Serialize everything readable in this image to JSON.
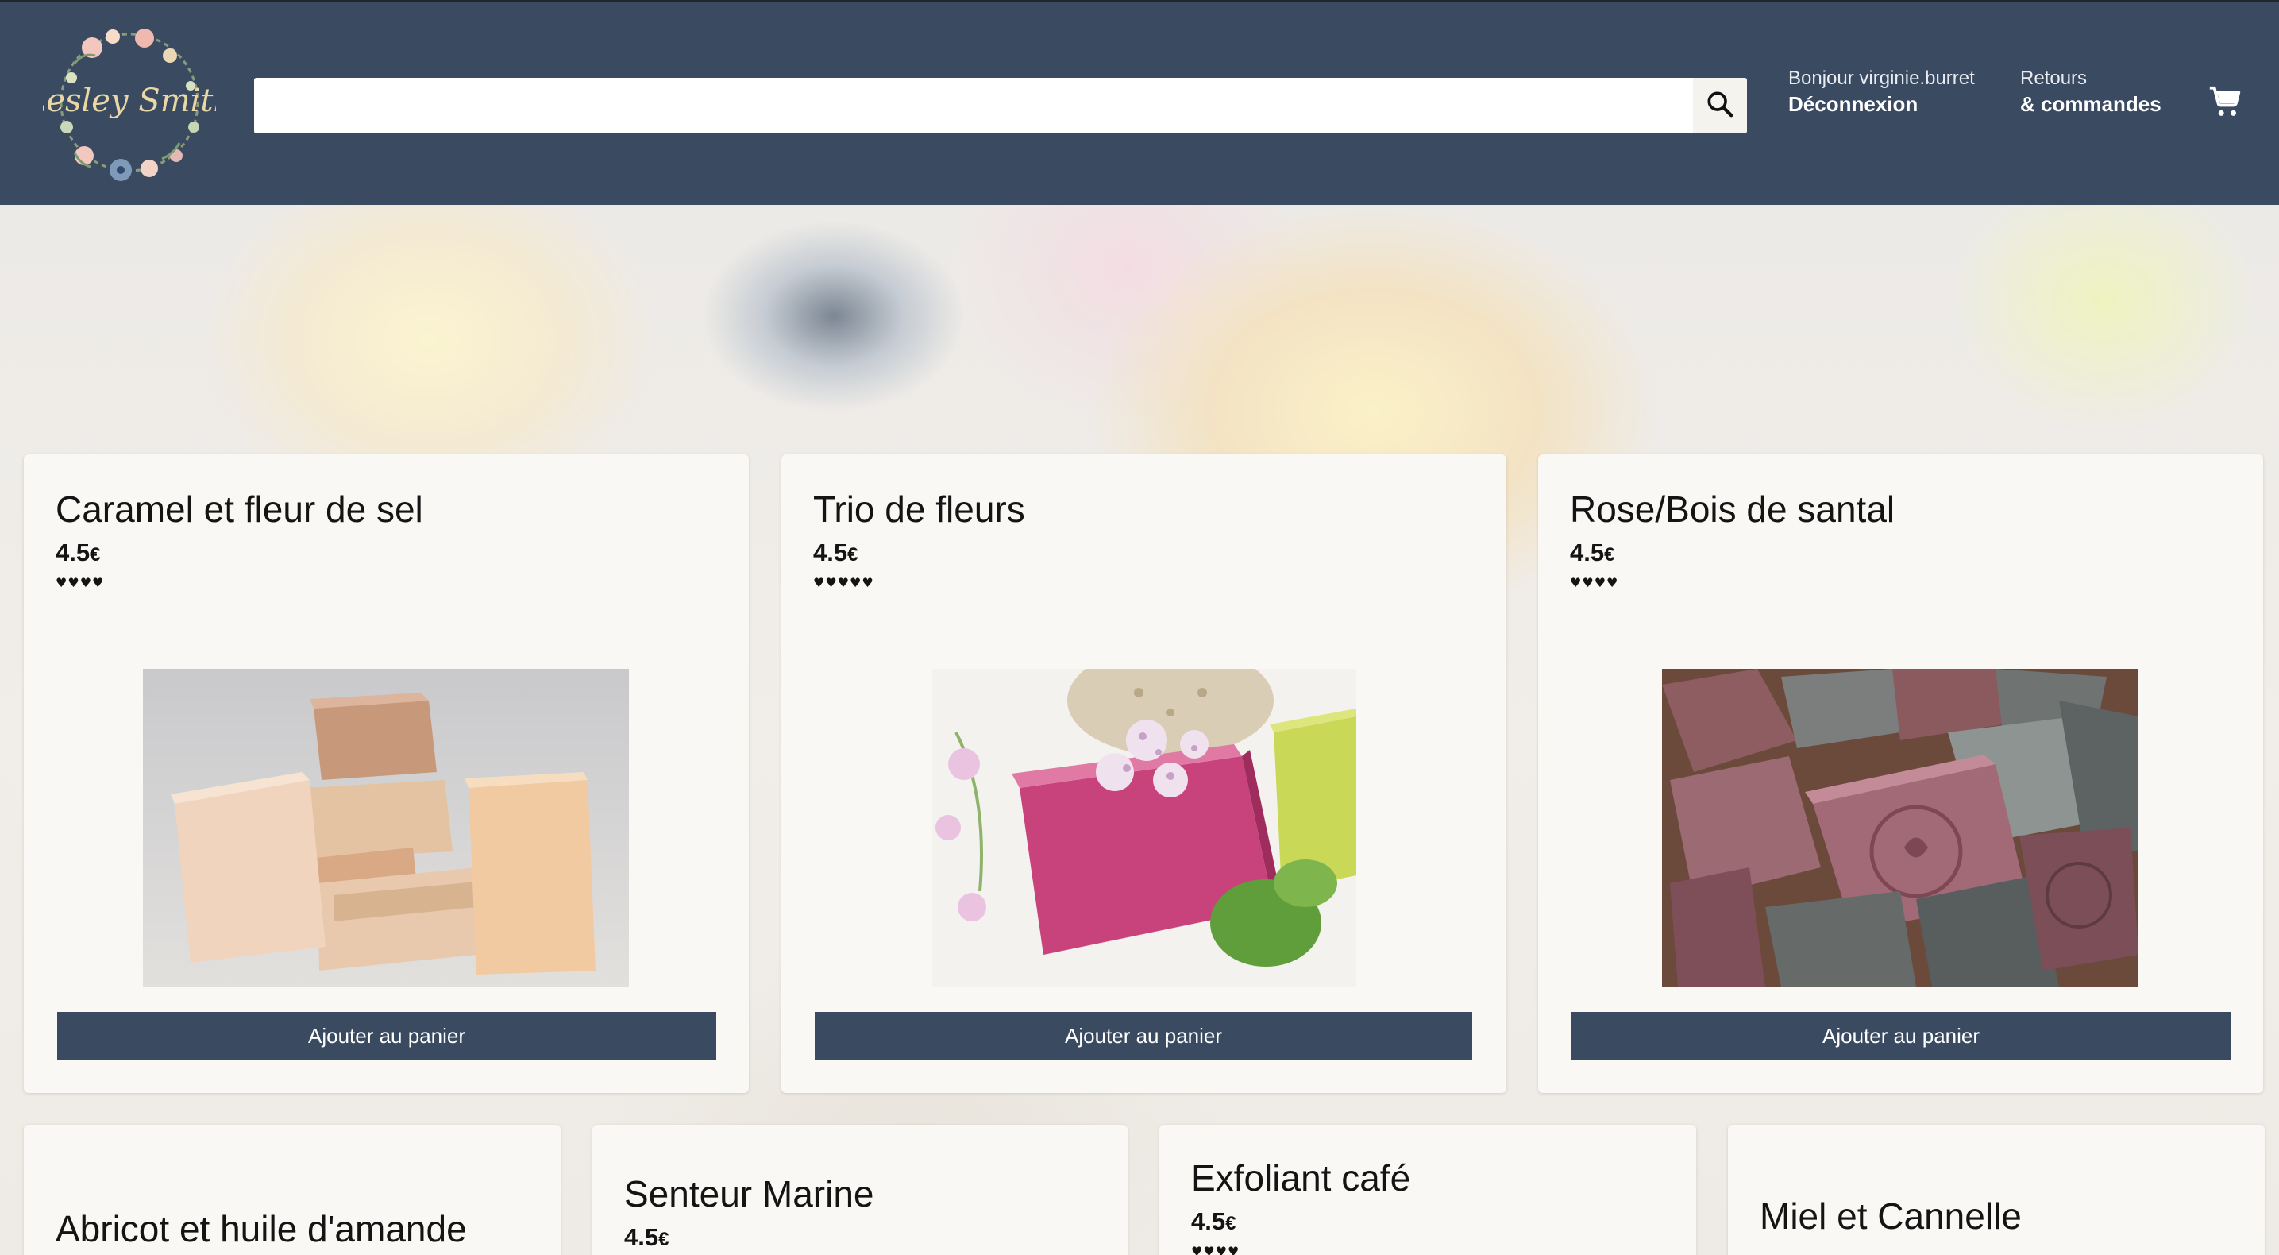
{
  "header": {
    "logo_text": "Lesley Smith",
    "search": {
      "value": "",
      "placeholder": ""
    },
    "account": {
      "greeting": "Bonjour virginie.burret",
      "action": "Déconnexion"
    },
    "orders": {
      "line1": "Retours",
      "line2": "& commandes"
    },
    "cart_icon": "shopping-cart-icon",
    "search_icon": "magnifier-icon"
  },
  "colors": {
    "header_bg": "#3a4a61",
    "button_bg": "#3a4a61",
    "card_bg": "#faf8f5"
  },
  "products": [
    {
      "name": "Caramel et fleur de sel",
      "price": "4.5",
      "currency": "€",
      "rating": 4,
      "rating_text": "♥♥♥♥",
      "button": "Ajouter au panier"
    },
    {
      "name": "Trio de fleurs",
      "price": "4.5",
      "currency": "€",
      "rating": 5,
      "rating_text": "♥♥♥♥♥",
      "button": "Ajouter au panier"
    },
    {
      "name": "Rose/Bois de santal",
      "price": "4.5",
      "currency": "€",
      "rating": 4,
      "rating_text": "♥♥♥♥",
      "button": "Ajouter au panier"
    },
    {
      "name": "Abricot et huile d'amande"
    },
    {
      "name": "Senteur Marine",
      "price": "4.5",
      "currency": "€"
    },
    {
      "name": "Exfoliant café",
      "price": "4.5",
      "currency": "€",
      "rating_text": "♥♥♥♥"
    },
    {
      "name": "Miel et Cannelle"
    }
  ]
}
